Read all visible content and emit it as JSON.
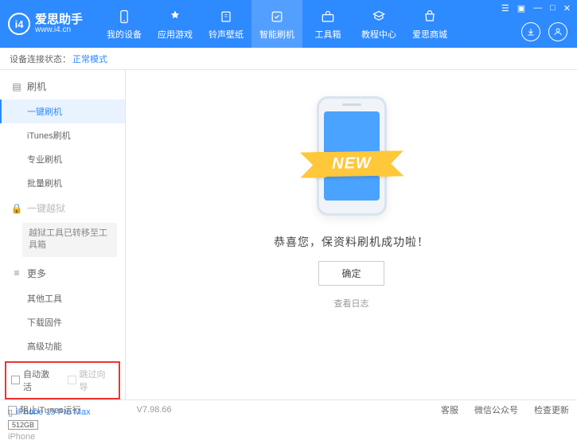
{
  "app": {
    "title": "爱思助手",
    "subtitle": "www.i4.cn"
  },
  "nav": [
    {
      "label": "我的设备"
    },
    {
      "label": "应用游戏"
    },
    {
      "label": "铃声壁纸"
    },
    {
      "label": "智能刷机"
    },
    {
      "label": "工具箱"
    },
    {
      "label": "教程中心"
    },
    {
      "label": "爱思商城"
    }
  ],
  "status": {
    "label": "设备连接状态：",
    "value": "正常模式"
  },
  "sidebar": {
    "flash": "刷机",
    "items": {
      "oneKey": "一键刷机",
      "itunes": "iTunes刷机",
      "pro": "专业刷机",
      "batch": "批量刷机"
    },
    "jailbreak": "一键越狱",
    "jailbreakNote": "越狱工具已转移至工具箱",
    "more": "更多",
    "moreItems": {
      "other": "其他工具",
      "download": "下载固件",
      "advanced": "高级功能"
    }
  },
  "checks": {
    "autoActivate": "自动激活",
    "skipGuide": "跳过向导"
  },
  "device": {
    "name": "iPhone 15 Pro Max",
    "storage": "512GB",
    "type": "iPhone"
  },
  "main": {
    "ribbon": "NEW",
    "success": "恭喜您，保资料刷机成功啦！",
    "ok": "确定",
    "viewLog": "查看日志"
  },
  "footer": {
    "block": "阻止iTunes运行",
    "version": "V7.98.66",
    "links": {
      "service": "客服",
      "wechat": "微信公众号",
      "update": "检查更新"
    }
  }
}
